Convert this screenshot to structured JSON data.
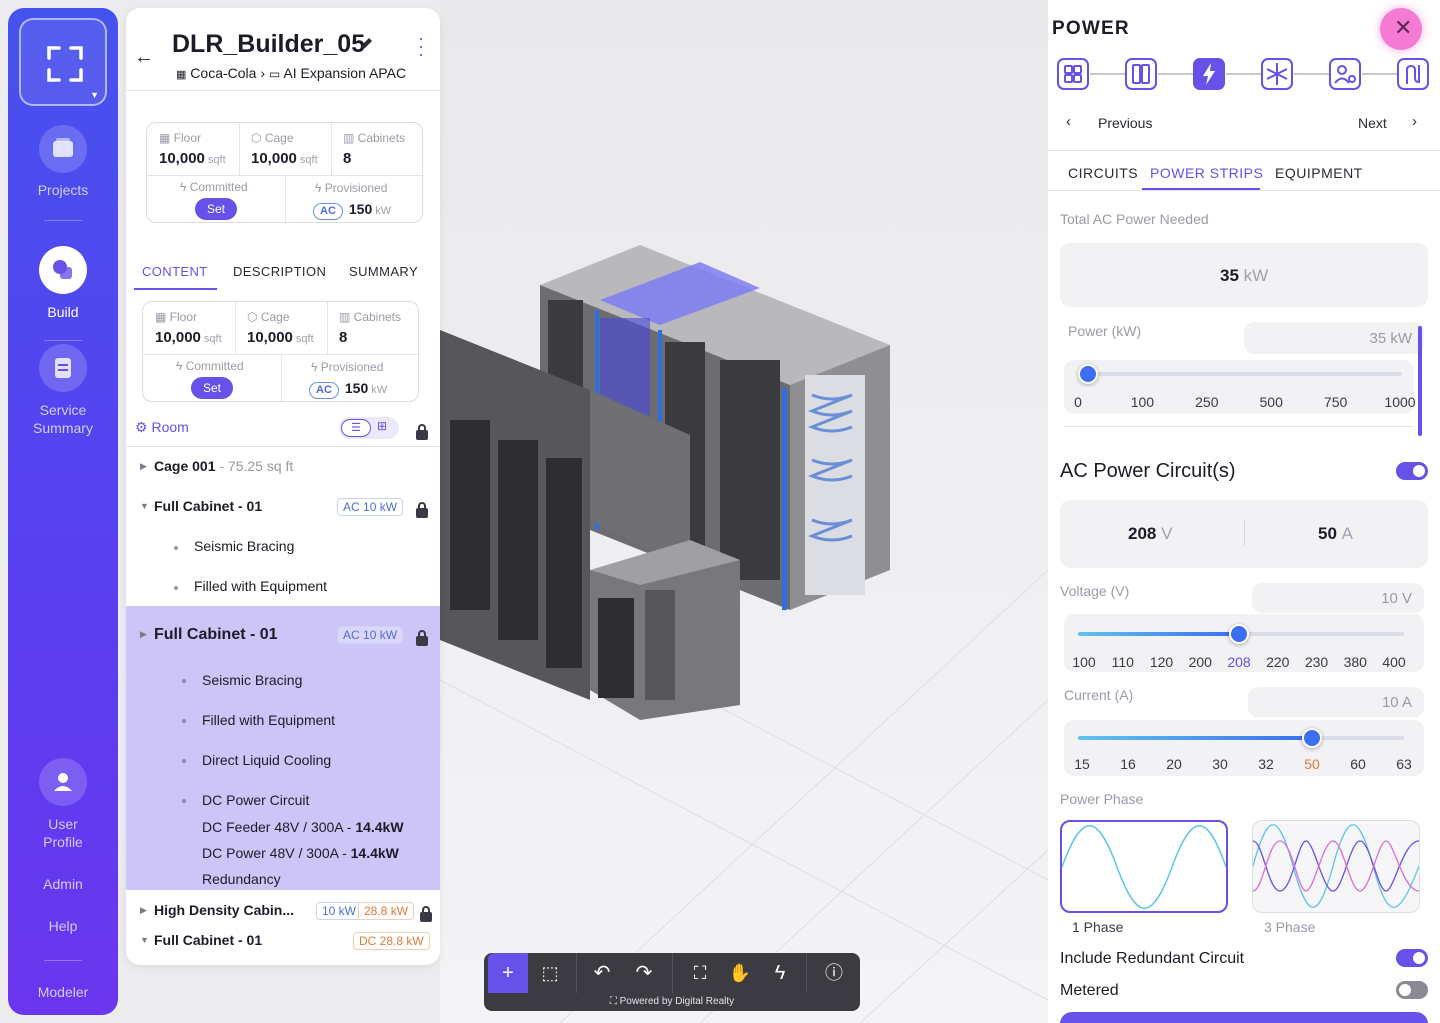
{
  "nav": {
    "items": [
      {
        "label": "Projects"
      },
      {
        "label": "Build"
      },
      {
        "label": "Service Summary"
      }
    ],
    "bottom": [
      {
        "label": "User Profile"
      },
      {
        "label": "Admin"
      },
      {
        "label": "Help"
      },
      {
        "label": "Modeler"
      }
    ]
  },
  "project": {
    "title": "DLR_Builder_05",
    "breadcrumb": {
      "company": "Coca-Cola",
      "folder": "AI Expansion APAC"
    },
    "stats": {
      "floor_label": "Floor",
      "floor_value": "10,000",
      "floor_unit": "sqft",
      "cage_label": "Cage",
      "cage_value": "10,000",
      "cage_unit": "sqft",
      "cabinets_label": "Cabinets",
      "cabinets_value": "8",
      "committed_label": "Committed",
      "set_label": "Set",
      "provisioned_label": "Provisioned",
      "prov_badge": "AC",
      "prov_value": "150",
      "prov_unit": "kW"
    },
    "tabs": [
      "CONTENT",
      "DESCRIPTION",
      "SUMMARY"
    ],
    "room_label": "Room",
    "tree": {
      "cage": {
        "title": "Cage 001",
        "sub": " - 75.25 sq ft"
      },
      "cab1": {
        "title": "Full Cabinet  - 01",
        "badge": "AC",
        "kw": "10 kW",
        "children": [
          "Seismic Bracing",
          "Filled with Equipment"
        ]
      },
      "cab2": {
        "title": "Full Cabinet  - 01",
        "badge": "AC",
        "kw": "10 kW",
        "children": [
          "Seismic Bracing",
          "Filled with Equipment",
          "Direct Liquid Cooling",
          "DC Power Circuit"
        ],
        "dc1_text": "DC Feeder 48V / 300A - ",
        "dc1_val": "14.4kW",
        "dc2_text": "DC Power 48V / 300A - ",
        "dc2_val": "14.4kW",
        "dc3_text": "Redundancy"
      },
      "hd": {
        "title": "High Density Cabin...",
        "kw1": "10 kW",
        "kw2": "28.8 kW"
      },
      "cab3": {
        "title": "Full Cabinet  - 01",
        "kw": "DC 28.8 kW"
      }
    }
  },
  "power": {
    "title": "POWER",
    "prev_label": "Previous",
    "next_label": "Next",
    "tabs": [
      "CIRCUITS",
      "POWER STRIPS",
      "EQUIPMENT"
    ],
    "total_label": "Total AC Power Needed",
    "total_value": "35",
    "total_unit": "kW",
    "power_label": "Power (kW)",
    "power_value": "35 kW",
    "power_ticks": [
      "0",
      "100",
      "250",
      "500",
      "750",
      "1000"
    ],
    "power_fraction": 0.03,
    "ac_label": "AC Power Circuit(s)",
    "volt_value": "208",
    "volt_unit": "V",
    "amp_value": "50",
    "amp_unit": "A",
    "voltage_label": "Voltage (V)",
    "voltage_field": "10 V",
    "voltage_ticks": [
      "100",
      "110",
      "120",
      "200",
      "208",
      "220",
      "230",
      "380",
      "400"
    ],
    "voltage_selected": "208",
    "current_label": "Current (A)",
    "current_field": "10 A",
    "current_ticks": [
      "15",
      "16",
      "20",
      "30",
      "32",
      "50",
      "60",
      "63"
    ],
    "current_selected": "50",
    "phase_label": "Power Phase",
    "phase1": "1 Phase",
    "phase3": "3 Phase",
    "redundant_label": "Include Redundant Circuit",
    "metered_label": "Metered",
    "accent": "#6652e8",
    "highlight": "#e07a3a"
  },
  "toolbar": {
    "footer": "Powered by Digital Realty"
  }
}
